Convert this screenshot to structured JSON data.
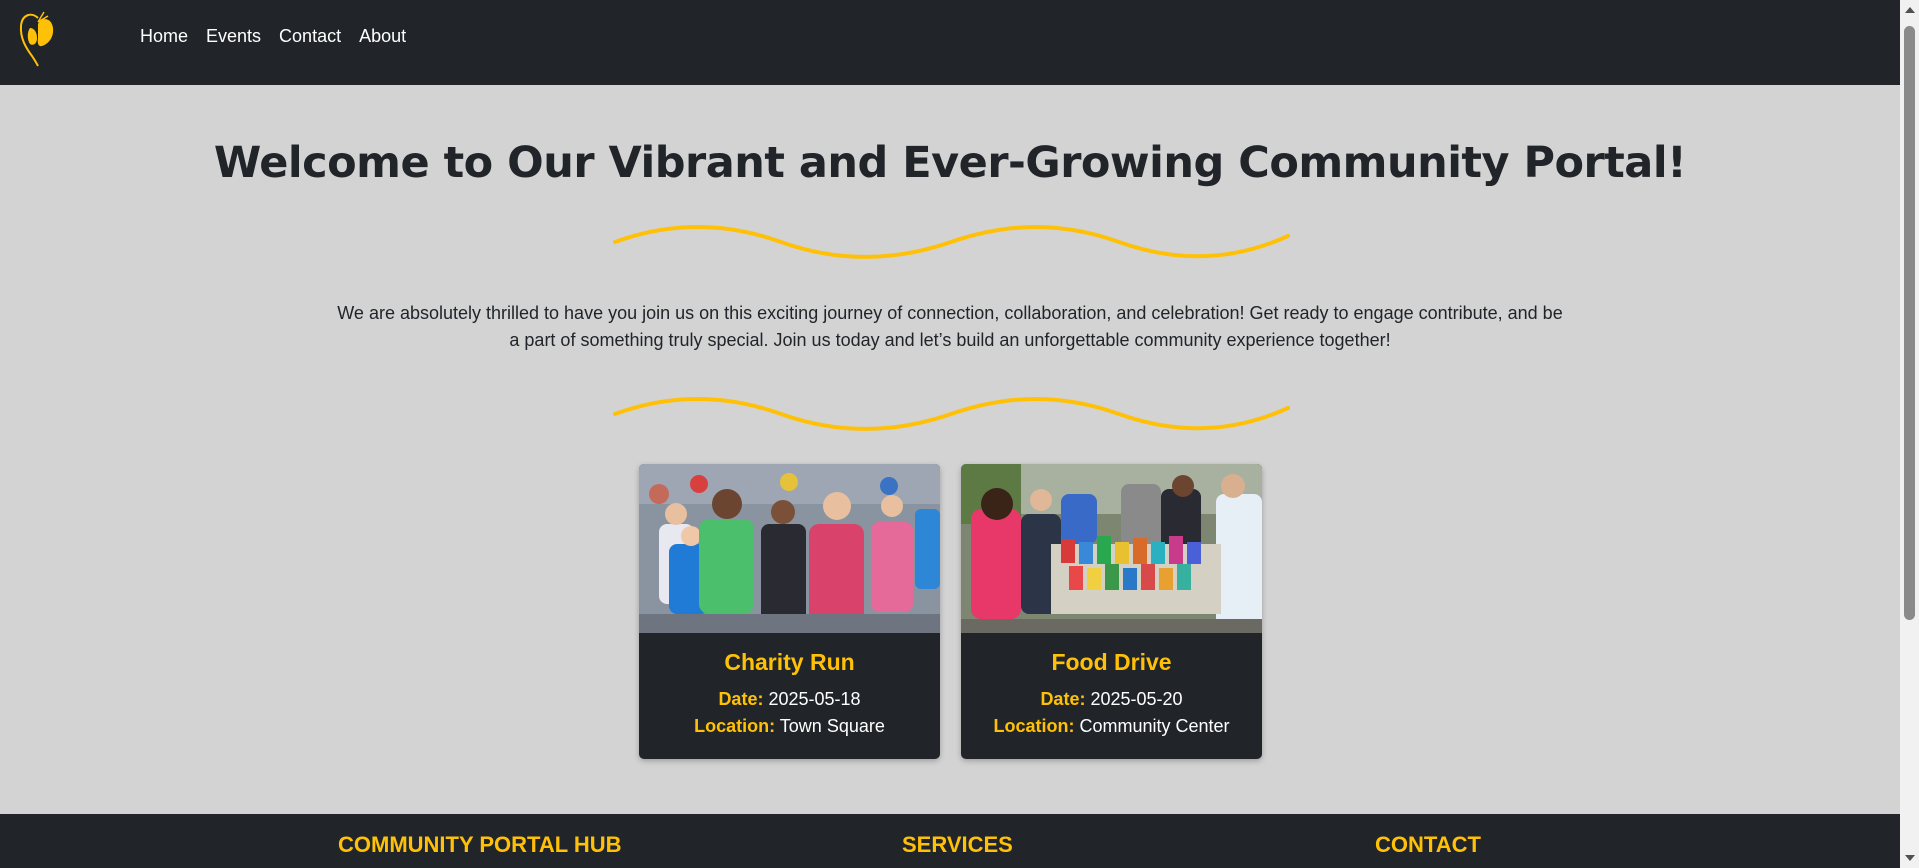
{
  "nav": {
    "logo_icon": "butterfly-logo-icon",
    "links": [
      "Home",
      "Events",
      "Contact",
      "About"
    ]
  },
  "hero": {
    "title": "Welcome to Our Vibrant and Ever-Growing Community Portal!",
    "intro": "We are absolutely thrilled to have you join us on this exciting journey of connection, collaboration, and celebration! Get ready to engage contribute, and be a part of something truly special. Join us today and let’s build an unforgettable community experience together!"
  },
  "events": [
    {
      "title": "Charity Run",
      "date_label": "Date:",
      "date": "2025-05-18",
      "location_label": "Location:",
      "location": "Town Square",
      "image": "charity-run-photo"
    },
    {
      "title": "Food Drive",
      "date_label": "Date:",
      "date": "2025-05-20",
      "location_label": "Location:",
      "location": "Community Center",
      "image": "food-drive-photo"
    }
  ],
  "footer": {
    "columns": [
      "COMMUNITY PORTAL HUB",
      "SERVICES",
      "CONTACT"
    ]
  },
  "colors": {
    "accent": "#ffc107",
    "dark": "#212529",
    "background": "#d3d3d3"
  }
}
